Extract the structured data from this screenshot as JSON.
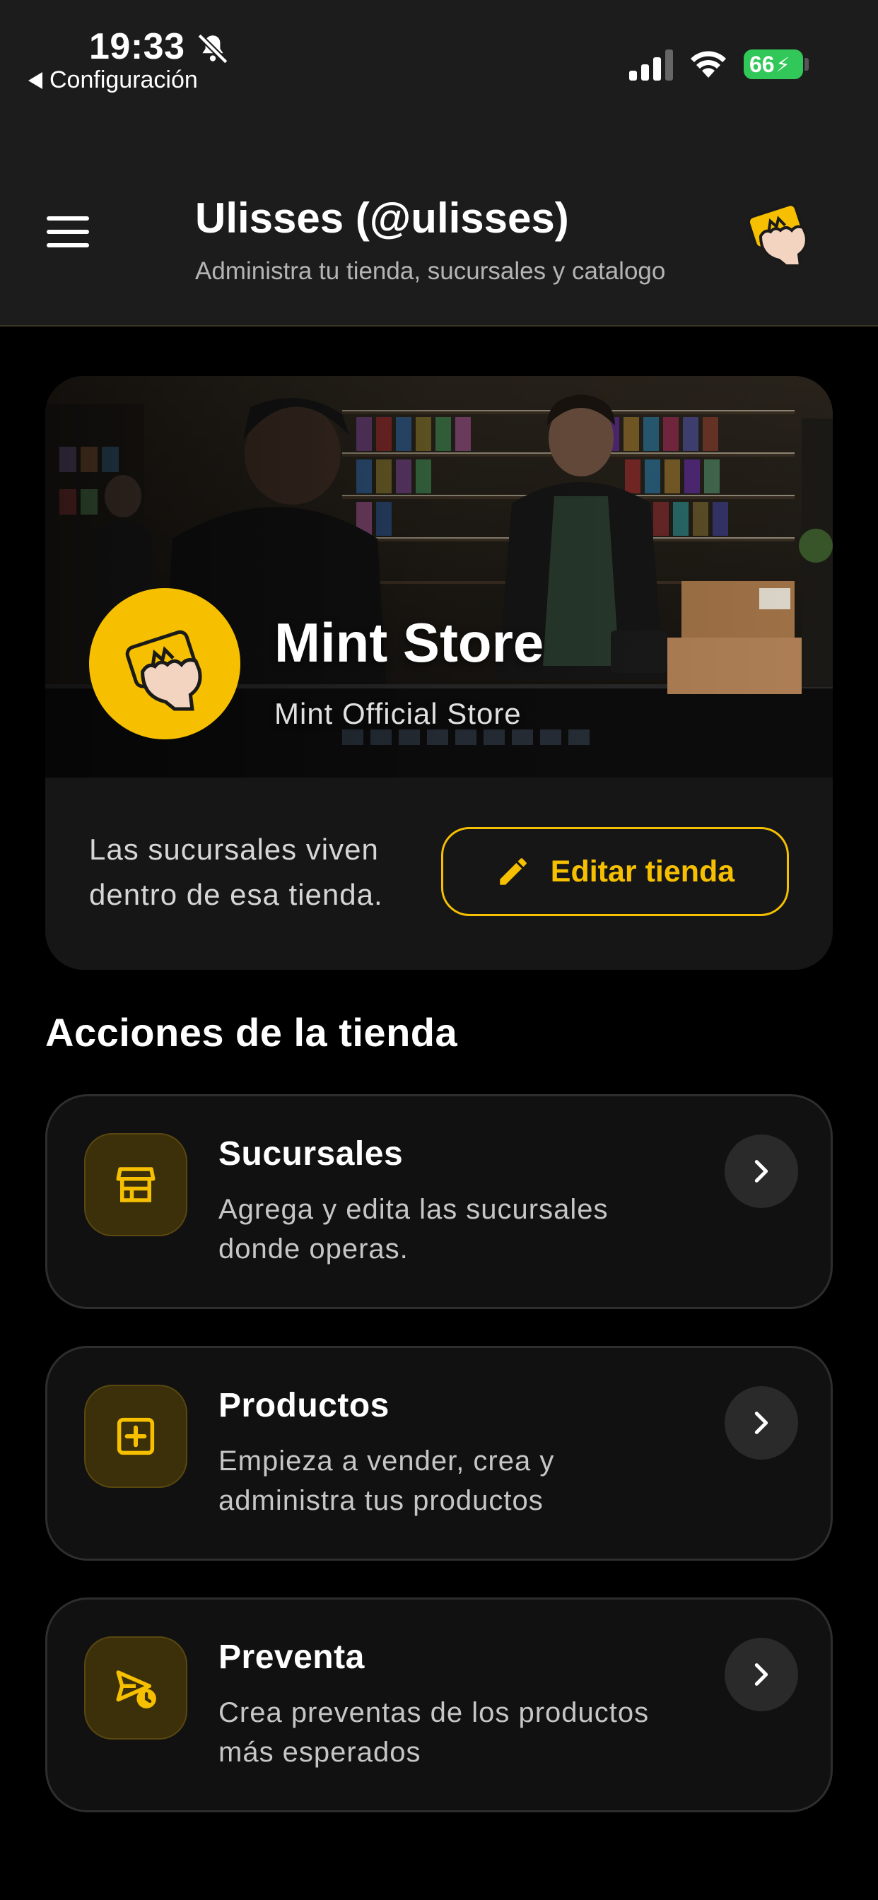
{
  "status_bar": {
    "time": "19:33",
    "back_label": "Configuración",
    "battery": "66",
    "icons": [
      "bell-slash-icon",
      "signal-icon",
      "wifi-icon",
      "battery-charging-icon"
    ]
  },
  "header": {
    "title": "Ulisses (@ulisses)",
    "subtitle": "Administra tu tienda, sucursales y catalogo",
    "menu_icon": "hamburger-icon",
    "logo_icon": "fist-card-logo-icon"
  },
  "store": {
    "name": "Mint Store",
    "subtitle": "Mint Official Store",
    "note": "Las sucursales viven dentro de esa tienda.",
    "edit_label": "Editar tienda",
    "edit_icon": "pencil-icon"
  },
  "section": {
    "title": "Acciones de la tienda"
  },
  "actions": [
    {
      "title": "Sucursales",
      "description": "Agrega y edita las sucursales donde operas.",
      "icon": "store-icon"
    },
    {
      "title": "Productos",
      "description": "Empieza a vender, crea y administra tus productos",
      "icon": "add-box-icon"
    },
    {
      "title": "Preventa",
      "description": "Crea preventas de los productos más esperados",
      "icon": "send-clock-icon"
    }
  ],
  "colors": {
    "accent": "#f6c000",
    "background": "#000000",
    "header_bg": "#1c1c1c",
    "card_bg": "#111111",
    "battery_green": "#32c759"
  }
}
